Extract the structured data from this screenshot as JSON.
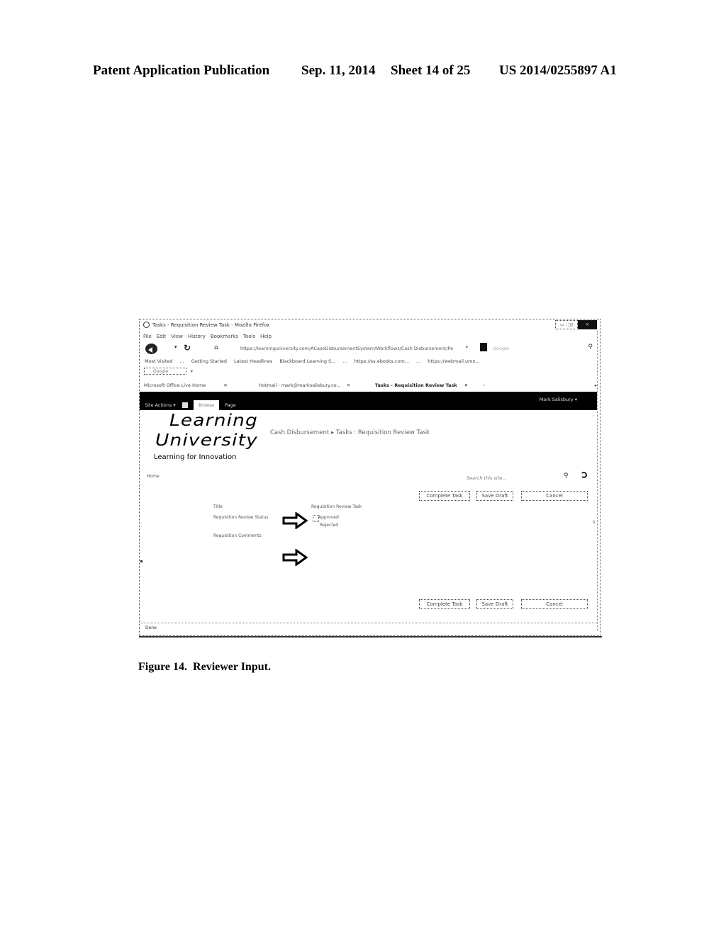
{
  "patent_header": {
    "publication": "Patent Application Publication",
    "date": "Sep. 11, 2014",
    "sheet": "Sheet 14 of 25",
    "number": "US 2014/0255897 A1"
  },
  "browser": {
    "window_title": "Tasks - Requisition Review Task - Mozilla Firefox",
    "window_controls": {
      "restore": "▭ : ▯▯",
      "close": "✕"
    },
    "menu": [
      "File",
      "Edit",
      "View",
      "History",
      "Bookmarks",
      "Tools",
      "Help"
    ],
    "url": "https://learninguniversity.com/ACaseDisbursementSystem/Workflows/Cash Disbursement/Pe",
    "search_placeholder": "Google",
    "bookmarks": [
      "Most Visited",
      "...",
      "Getting Started",
      "Latest Headlines",
      "Blackboard Learning S...",
      "...",
      "https://ss.ebooks.com...",
      "...",
      "https://webmail.umn..."
    ],
    "addon_label": "Google",
    "tabs": [
      {
        "label": "Microsoft Office Live Home",
        "active": false
      },
      {
        "label": "Hotmail - mark@marksalisbury.co...",
        "active": false
      },
      {
        "label": "Tasks - Requisition Review Task",
        "active": true
      }
    ],
    "new_tab": "+",
    "status": "Done"
  },
  "sharepoint": {
    "user": "Mark Salisbury ▾",
    "site_actions": "Site Actions ▾",
    "ribbon_tabs": [
      "Browse",
      "Page"
    ],
    "logo": {
      "line1": "Learning",
      "line2": "University",
      "tagline": "Learning for Innovation"
    },
    "breadcrumb": "Cash Disbursement ▸ Tasks : Requisition Review Task",
    "home_link": "Home",
    "search_placeholder": "Search this site...",
    "buttons": {
      "complete": "Complete Task",
      "save": "Save Draft",
      "cancel": "Cancel"
    },
    "form": {
      "title_label": "Title",
      "title_value": "Requisition Review Task",
      "status_label": "Requisition Review Status",
      "status_options": [
        "Approved",
        "Rejected"
      ],
      "comments_label": "Requisition Comments"
    }
  },
  "caption": "Figure 14.  Reviewer Input."
}
